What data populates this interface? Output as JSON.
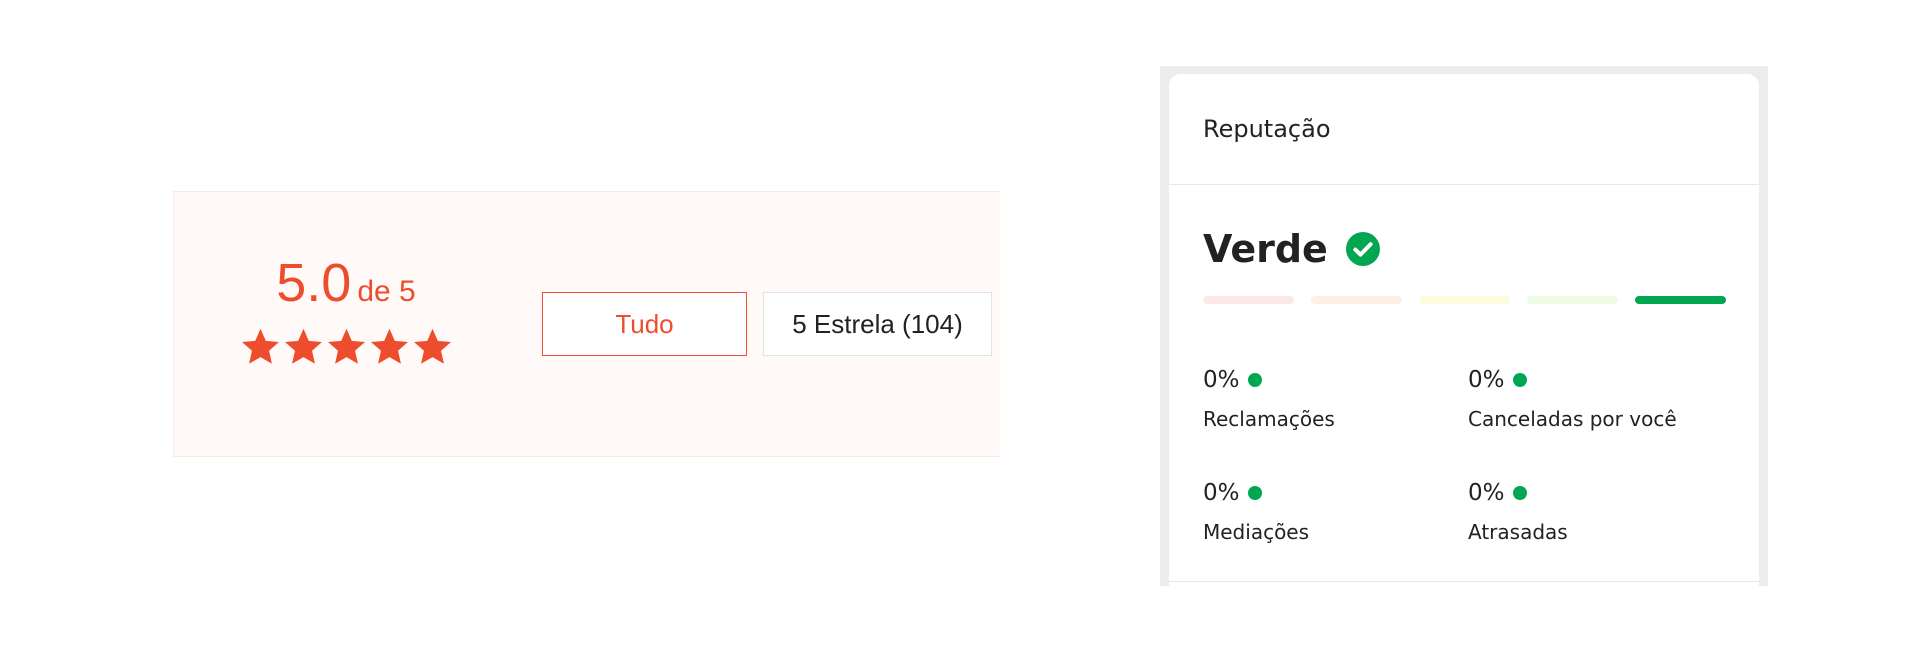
{
  "rating": {
    "score": "5.0",
    "out_of": "de 5",
    "stars_filled": 5,
    "stars_total": 5,
    "star_color": "#ee4d2d",
    "filters": {
      "all_label": "Tudo",
      "five_star_label": "5 Estrela (104)"
    }
  },
  "reputation": {
    "title": "Reputação",
    "level": "Verde",
    "level_icon": "check-circle-icon",
    "thermometer_colors": [
      "#fde8e8",
      "#fdeee6",
      "#fefbdc",
      "#eefce3",
      "#00a650"
    ],
    "active_segment": 5,
    "metrics": [
      {
        "value": "0%",
        "label": "Reclamações"
      },
      {
        "value": "0%",
        "label": "Canceladas por você"
      },
      {
        "value": "0%",
        "label": "Mediações"
      },
      {
        "value": "0%",
        "label": "Atrasadas"
      }
    ],
    "status_color": "#00a650"
  }
}
